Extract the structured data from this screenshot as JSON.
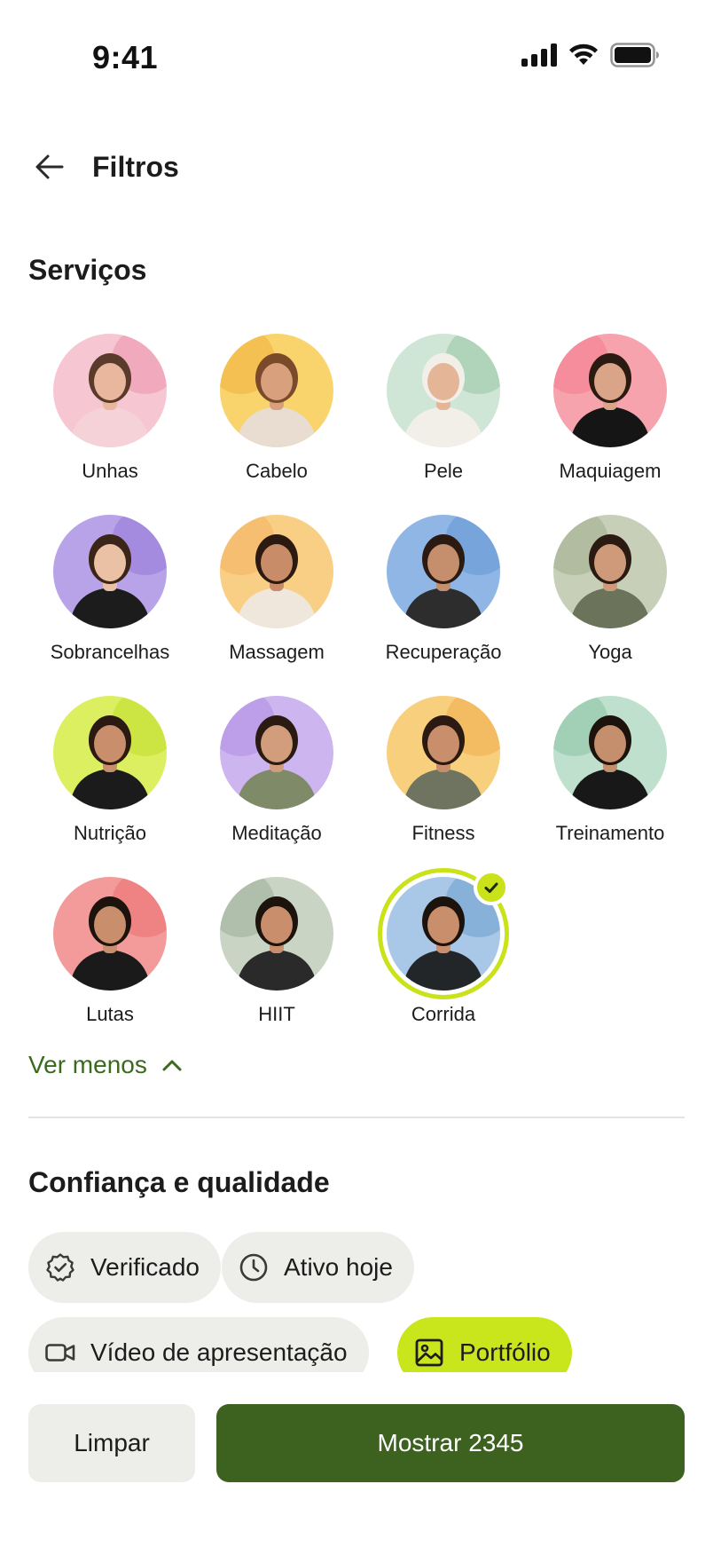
{
  "status_bar": {
    "time": "9:41"
  },
  "header": {
    "title": "Filtros"
  },
  "services": {
    "title": "Serviços",
    "items": [
      {
        "label": "Unhas",
        "selected": false,
        "bg": "#f6c6d3",
        "accent": "#ef9fb6",
        "skin": "#e8b79d",
        "shirt": "#f4d2d8",
        "hair": "#5a3b2b"
      },
      {
        "label": "Cabelo",
        "selected": false,
        "bg": "#f9d36c",
        "accent": "#f3b949",
        "skin": "#d9a07e",
        "shirt": "#e8ddd0",
        "hair": "#7a4a2a"
      },
      {
        "label": "Pele",
        "selected": false,
        "bg": "#cfe6d6",
        "accent": "#a5cdb0",
        "skin": "#e5b597",
        "shirt": "#f2efe9",
        "hair": "#f2efe9"
      },
      {
        "label": "Maquiagem",
        "selected": false,
        "bg": "#f6a3ae",
        "accent": "#f48696",
        "skin": "#d9a488",
        "shirt": "#151515",
        "hair": "#2b1a12"
      },
      {
        "label": "Sobrancelhas",
        "selected": false,
        "bg": "#b8a3e8",
        "accent": "#9d83de",
        "skin": "#ebc1a6",
        "shirt": "#1c1c1c",
        "hair": "#3a2518"
      },
      {
        "label": "Massagem",
        "selected": false,
        "bg": "#f9cf86",
        "accent": "#f4b86a",
        "skin": "#c98c68",
        "shirt": "#efe7dc",
        "hair": "#2c1a10"
      },
      {
        "label": "Recuperação",
        "selected": false,
        "bg": "#8fb6e4",
        "accent": "#6f9ed8",
        "skin": "#c58f6e",
        "shirt": "#2d2d2d",
        "hair": "#2b1a12"
      },
      {
        "label": "Yoga",
        "selected": false,
        "bg": "#c7cfb8",
        "accent": "#a9b598",
        "skin": "#cf9a7a",
        "shirt": "#6b735a",
        "hair": "#2b1a12"
      },
      {
        "label": "Nutrição",
        "selected": false,
        "bg": "#dcef60",
        "accent": "#c8e23a",
        "skin": "#c98e6c",
        "shirt": "#1b1b1b",
        "hair": "#2b1a12"
      },
      {
        "label": "Meditação",
        "selected": false,
        "bg": "#cdb5ef",
        "accent": "#b797e6",
        "skin": "#d19d7c",
        "shirt": "#7f8a68",
        "hair": "#2b1a12"
      },
      {
        "label": "Fitness",
        "selected": false,
        "bg": "#f8cf7c",
        "accent": "#f1b55a",
        "skin": "#c98e6c",
        "shirt": "#6f7460",
        "hair": "#2b1a12"
      },
      {
        "label": "Treinamento",
        "selected": false,
        "bg": "#bfe0cc",
        "accent": "#98cbb0",
        "skin": "#c58e6c",
        "shirt": "#181818",
        "hair": "#1c130d"
      },
      {
        "label": "Lutas",
        "selected": false,
        "bg": "#f39a9a",
        "accent": "#ee7b7b",
        "skin": "#c98e6c",
        "shirt": "#1a1a1a",
        "hair": "#1c130d"
      },
      {
        "label": "HIIT",
        "selected": false,
        "bg": "#c9d4c5",
        "accent": "#a7b8a2",
        "skin": "#c98e6c",
        "shirt": "#2a2a2a",
        "hair": "#1c130d"
      },
      {
        "label": "Corrida",
        "selected": true,
        "bg": "#a9c7e6",
        "accent": "#7ea9d6",
        "skin": "#c98e6c",
        "shirt": "#222628",
        "hair": "#1c130d"
      }
    ]
  },
  "ver_menos": {
    "label": "Ver menos"
  },
  "trust": {
    "title": "Confiança e qualidade",
    "chips": [
      {
        "label": "Verificado",
        "icon": "verified-badge-icon",
        "active": false
      },
      {
        "label": "Ativo hoje",
        "icon": "clock-icon",
        "active": false
      },
      {
        "label": "Vídeo de apresentação",
        "icon": "video-camera-icon",
        "active": false
      },
      {
        "label": "Portfólio",
        "icon": "image-icon",
        "active": true
      }
    ]
  },
  "footer": {
    "clear_label": "Limpar",
    "show_label": "Mostrar 2345"
  },
  "colors": {
    "accent_lime": "#c9e51c",
    "primary_green": "#3d6220",
    "link_green": "#3a6a1e",
    "chip_bg": "#ededea"
  }
}
